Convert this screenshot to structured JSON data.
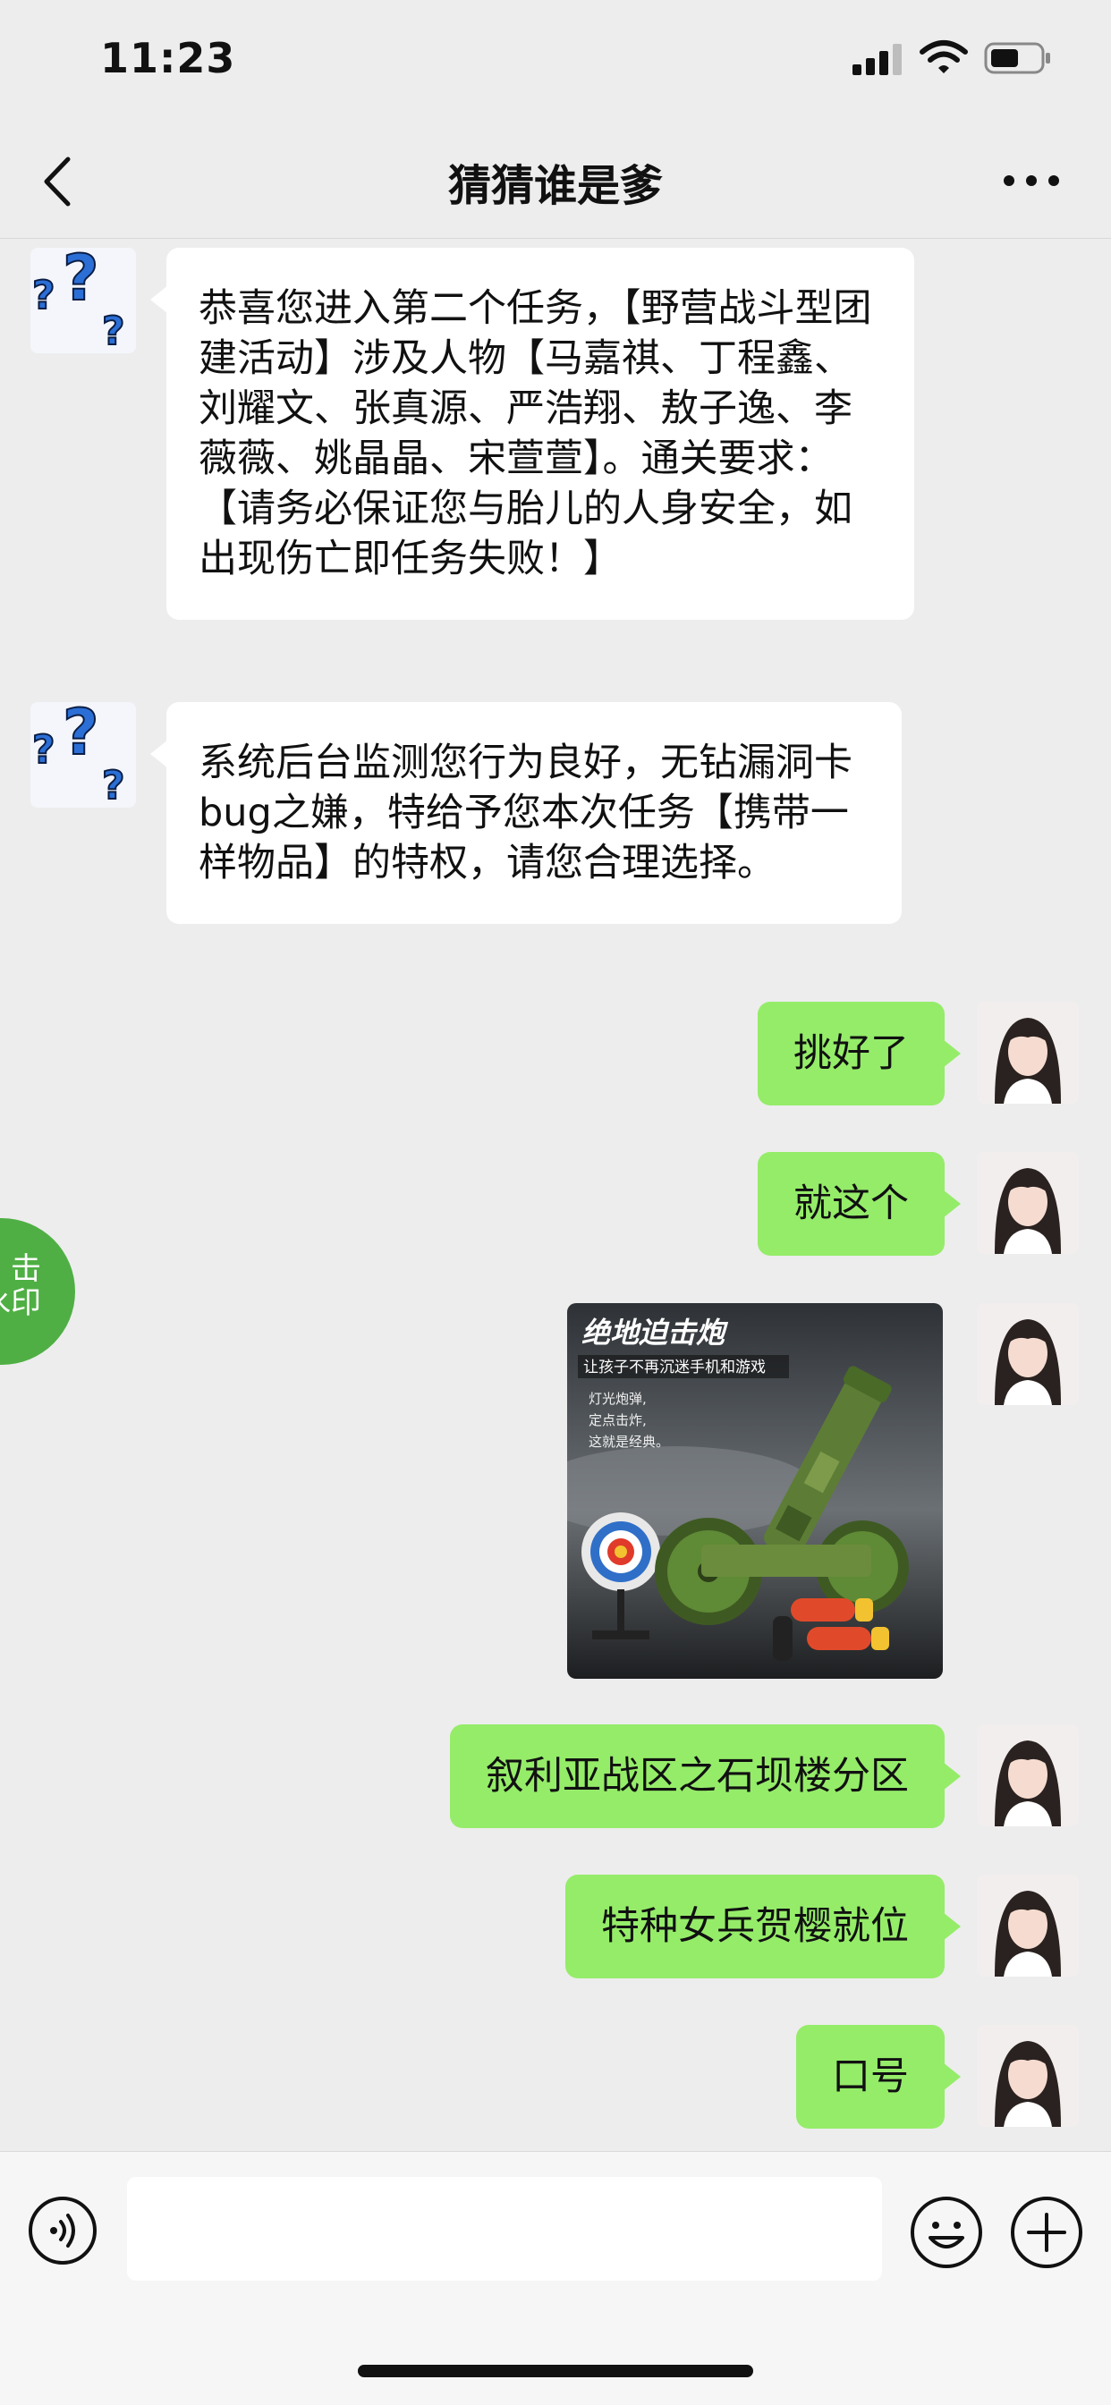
{
  "status_bar": {
    "time": "11:23"
  },
  "header": {
    "title": "猜猜谁是爹"
  },
  "messages": [
    {
      "from": "other",
      "text": "恭喜您进入第二个任务，【野营战斗型团建活动】涉及人物【马嘉祺、丁程鑫、刘耀文、张真源、严浩翔、敖子逸、李薇薇、姚晶晶、宋萱萱】。通关要求：【请务必保证您与胎儿的人身安全，如出现伤亡即任务失败！】"
    },
    {
      "from": "other",
      "text": "系统后台监测您行为良好，无钻漏洞卡bug之嫌，特给予您本次任务【携带一样物品】的特权，请您合理选择。"
    },
    {
      "from": "me",
      "text": "挑好了"
    },
    {
      "from": "me",
      "text": "就这个"
    },
    {
      "from": "me",
      "type": "image",
      "image": {
        "headline": "绝地迫击炮",
        "subline": "让孩子不再沉迷手机和游戏",
        "feature_1": "灯光炮弹,",
        "feature_2": "定点击炸,",
        "feature_3": "这就是经典。"
      }
    },
    {
      "from": "me",
      "text": "叙利亚战区之石坝楼分区"
    },
    {
      "from": "me",
      "text": "特种女兵贺樱就位"
    },
    {
      "from": "me",
      "text": "口号"
    }
  ],
  "floating_button": {
    "line1": "击",
    "line2": "水印"
  },
  "input_bar": {
    "placeholder": ""
  },
  "colors": {
    "outgoing_bubble": "#95ec69",
    "incoming_bubble": "#ffffff",
    "background": "#ededed"
  }
}
